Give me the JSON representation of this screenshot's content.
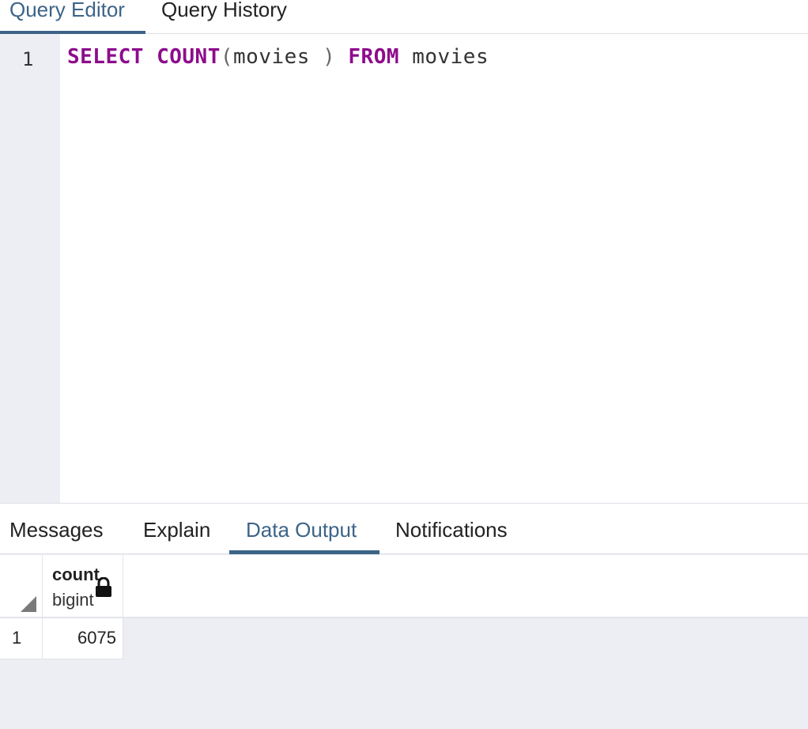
{
  "top_tabs": [
    {
      "label": "Query Editor",
      "active": true
    },
    {
      "label": "Query History",
      "active": false
    }
  ],
  "editor": {
    "line_number": "1",
    "tokens": {
      "select": "SELECT",
      "count": "COUNT",
      "paren_open": "(",
      "arg": "movies",
      "paren_close": " )",
      "from": "FROM",
      "table": "movies"
    }
  },
  "bottom_tabs": [
    {
      "label": "Messages",
      "active": false
    },
    {
      "label": "Explain",
      "active": false
    },
    {
      "label": "Data Output",
      "active": true
    },
    {
      "label": "Notifications",
      "active": false
    }
  ],
  "grid": {
    "columns": [
      {
        "name": "count",
        "type": "bigint",
        "icon": "lock-icon"
      }
    ],
    "rows": [
      {
        "num": "1",
        "values": [
          "6075"
        ]
      }
    ]
  },
  "colors": {
    "accent": "#3c6487",
    "keyword": "#8d0c8c",
    "gutter": "#eceef3"
  }
}
